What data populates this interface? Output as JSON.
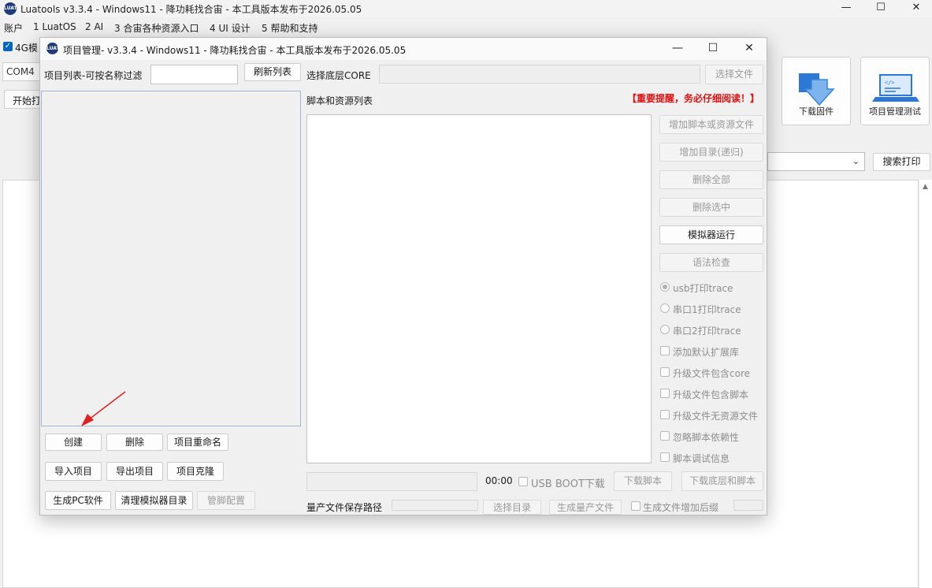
{
  "main_window": {
    "logo_text": "LUAT",
    "title": "Luatools  v3.3.4 - Windows11 - 降功耗找合宙 - 本工具版本发布于2026.05.05",
    "controls": {
      "minimize": "—",
      "maximize": "☐",
      "close": "✕"
    },
    "menu": [
      "账户",
      "1 LuatOS",
      "2 AI",
      "3 合宙各种资源入口",
      "4 UI 设计",
      "5 帮助和支持"
    ],
    "checkbox_label": "4G模",
    "com_port": "COM4",
    "start_button": "开始打",
    "download_firmware": "下载固件",
    "project_test": "项目管理测试",
    "search_print": "搜索打印"
  },
  "dialog": {
    "logo_text": "LUAT",
    "title": "项目管理- v3.3.4 - Windows11 - 降功耗找合宙 - 本工具版本发布于2026.05.05",
    "controls": {
      "minimize": "—",
      "maximize": "☐",
      "close": "✕"
    },
    "left": {
      "filter_label": "项目列表-可按名称过滤",
      "filter_value": "",
      "refresh": "刷新列表",
      "create": "创建",
      "delete": "删除",
      "rename": "项目重命名",
      "import": "导入项目",
      "export": "导出项目",
      "clone": "项目克隆",
      "gen_pc": "生成PC软件",
      "clean_sim": "清理模拟器目录",
      "pin_config": "管脚配置"
    },
    "right": {
      "core_label": "选择底层CORE",
      "core_value": "",
      "select_file": "选择文件",
      "scripts_label": "脚本和资源列表",
      "warning": "【重要提醒，务必仔细阅读！】",
      "add_file": "增加脚本或资源文件",
      "add_dir": "增加目录(递归)",
      "delete_all": "删除全部",
      "delete_selected": "删除选中",
      "simulator_run": "模拟器运行",
      "syntax_check": "语法检查",
      "radios": [
        "usb打印trace",
        "串口1打印trace",
        "串口2打印trace"
      ],
      "checkboxes": [
        "添加默认扩展库",
        "升级文件包含core",
        "升级文件包含脚本",
        "升级文件无资源文件",
        "忽略脚本依赖性",
        "脚本调试信息"
      ],
      "progress_time": "00:00",
      "usb_boot": "USB BOOT下载",
      "download_script": "下载脚本",
      "download_core_script": "下载底层和脚本",
      "output_path_label": "量产文件保存路径",
      "select_dir": "选择目录",
      "gen_prod": "生成量产文件",
      "suffix": "生成文件增加后缀"
    }
  },
  "colors": {
    "accent": "#0067c0",
    "warning": "#e01010",
    "annotation_arrow": "#e02020"
  }
}
